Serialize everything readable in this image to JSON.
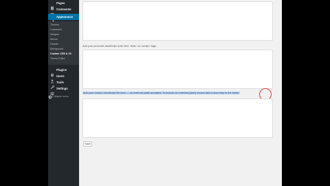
{
  "sidebar": {
    "items": [
      {
        "label": "Pages",
        "icon": "pages-icon"
      },
      {
        "label": "Comments",
        "icon": "comments-icon"
      },
      {
        "label": "Appearance",
        "icon": "paintbrush-icon"
      }
    ],
    "submenu": [
      "Themes",
      "Customize",
      "Widgets",
      "Menus",
      "Header",
      "Background",
      "Custom CSS & JS",
      "Theme Editor"
    ],
    "current_submenu": "Custom CSS & JS",
    "items_after": [
      {
        "label": "Plugins",
        "icon": "plugins-icon"
      },
      {
        "label": "Users",
        "icon": "users-icon"
      },
      {
        "label": "Tools",
        "icon": "tools-icon"
      },
      {
        "label": "Settings",
        "icon": "settings-icon"
      }
    ],
    "collapse_label": "Collapse menu"
  },
  "main": {
    "help_text_1": "Add your personal JavaScript code here. Note: no <script> tags.",
    "help_text_2": "Add your custom JavaScript file here — no external paths accepted. To include an external jQuery source add a new entry to the footer.",
    "save_label": "Save"
  },
  "colors": {
    "sidebar_bg": "#23282d",
    "active_item": "#0073aa",
    "selection": "#b3d4fc",
    "cursor_ring": "#e53935"
  }
}
